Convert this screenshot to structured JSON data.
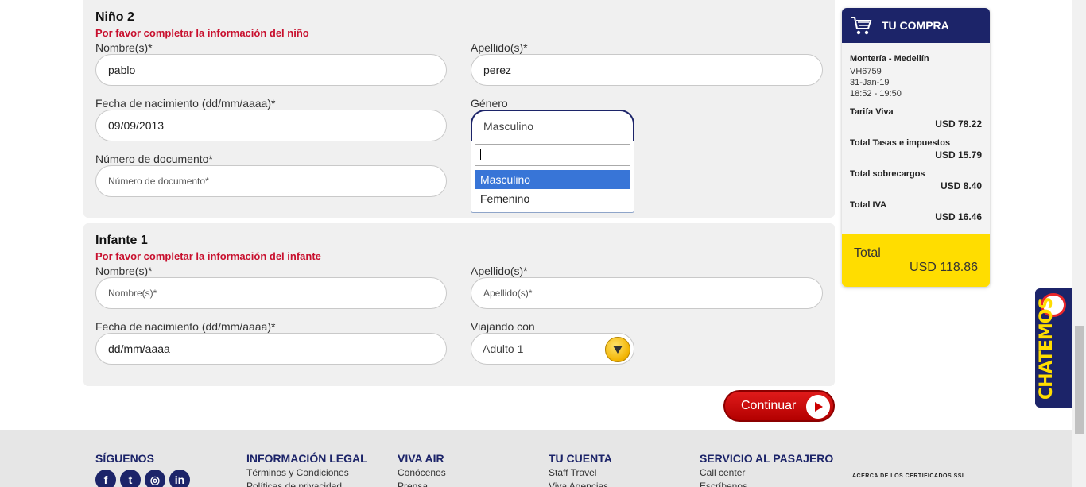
{
  "child": {
    "title": "Niño 2",
    "warning": "Por favor completar la información del niño",
    "first_name_label": "Nombre(s)*",
    "first_name_value": "pablo",
    "last_name_label": "Apellido(s)*",
    "last_name_value": "perez",
    "dob_label": "Fecha de nacimiento (dd/mm/aaaa)*",
    "dob_value": "09/09/2013",
    "gender_label": "Género",
    "gender_value": "Masculino",
    "gender_options": [
      "Masculino",
      "Femenino"
    ],
    "doc_label": "Número de documento*",
    "doc_placeholder": "Número de documento*"
  },
  "infant": {
    "title": "Infante 1",
    "warning": "Por favor completar la información del infante",
    "first_name_label": "Nombre(s)*",
    "first_name_placeholder": "Nombre(s)*",
    "last_name_label": "Apellido(s)*",
    "last_name_placeholder": "Apellido(s)*",
    "dob_label": "Fecha de nacimiento (dd/mm/aaaa)*",
    "dob_value": "dd/mm/aaaa",
    "travel_with_label": "Viajando con",
    "travel_with_value": "Adulto 1"
  },
  "continue_label": "Continuar",
  "cart": {
    "title": "TU COMPRA",
    "route": "Montería - Medellín",
    "flight": "VH6759",
    "date": "31-Jan-19",
    "time": "18:52 - 19:50",
    "fare_label": "Tarifa Viva",
    "fare_value": "USD 78.22",
    "taxes_label": "Total Tasas e impuestos",
    "taxes_value": "USD 15.79",
    "surcharges_label": "Total sobrecargos",
    "surcharges_value": "USD 8.40",
    "iva_label": "Total IVA",
    "iva_value": "USD 16.46",
    "total_label": "Total",
    "total_value": "USD 118.86",
    "total_color": "#ffdd00"
  },
  "chat_label": "CHATEMOS",
  "footer": {
    "follow_title": "SÍGUENOS",
    "social_icons": [
      "facebook-icon",
      "twitter-icon",
      "instagram-icon",
      "linkedin-icon"
    ],
    "legal_title": "INFORMACIÓN LEGAL",
    "legal_links": [
      "Términos y Condiciones",
      "Políticas de privacidad"
    ],
    "vivaair_title": "VIVA AIR",
    "vivaair_links": [
      "Conócenos",
      "Prensa"
    ],
    "account_title": "TU CUENTA",
    "account_links": [
      "Staff Travel",
      "Viva Agencias"
    ],
    "service_title": "SERVICIO AL PASAJERO",
    "service_links": [
      "Call center",
      "Escríbenos"
    ],
    "ssl_text": "ACERCA DE LOS CERTIFICADOS SSL"
  },
  "colors": {
    "brand_navy": "#1c2469",
    "warning_red": "#c8102e",
    "button_red": "#cc0000",
    "highlight_blue": "#3875d7"
  }
}
